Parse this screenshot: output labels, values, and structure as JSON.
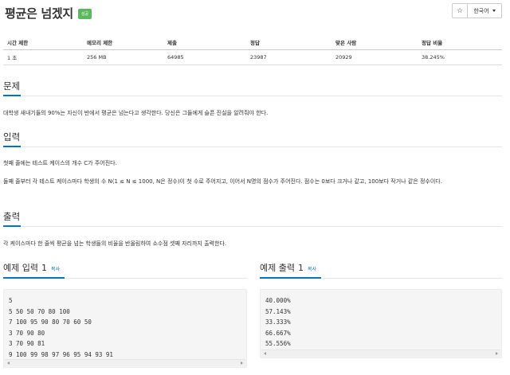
{
  "problem": {
    "title": "평균은 넘겠지",
    "badge": "성공"
  },
  "controls": {
    "star": "☆",
    "language": "한국어"
  },
  "info_table": {
    "headers": [
      "시간 제한",
      "메모리 제한",
      "제출",
      "정답",
      "맞은 사람",
      "정답 비율"
    ],
    "values": [
      "1 초",
      "256 MB",
      "64985",
      "23987",
      "20929",
      "38.245%"
    ]
  },
  "sections": {
    "problem_title": "문제",
    "problem_text": "대학생 새내기들의 90%는 자신이 반에서 평균은 넘는다고 생각한다. 당신은 그들에게 슬픈 진실을 알려줘야 한다.",
    "input_title": "입력",
    "input_text_1": "첫째 줄에는 테스트 케이스의 개수 C가 주어진다.",
    "input_text_2": "둘째 줄부터 각 테스트 케이스마다 학생의 수 N(1 ≤ N ≤ 1000, N은 정수)이 첫 수로 주어지고, 이어서 N명의 점수가 주어진다. 점수는 0보다 크거나 같고, 100보다 작거나 같은 정수이다.",
    "output_title": "출력",
    "output_text": "각 케이스마다 한 줄씩 평균을 넘는 학생들의 비율을 반올림하여 소수점 셋째 자리까지 출력한다."
  },
  "example_input": {
    "title": "예제 입력",
    "number": "1",
    "copy_label": "복사",
    "lines": [
      "5",
      "5 50 50 70 80 100",
      "7 100 95 90 80 70 60 50",
      "3 70 90 80",
      "3 70 90 81",
      "9 100 99 98 97 96 95 94 93 91"
    ]
  },
  "example_output": {
    "title": "예제 출력",
    "number": "1",
    "copy_label": "복사",
    "lines": [
      "40.000%",
      "57.143%",
      "33.333%",
      "66.667%",
      "55.556%"
    ]
  },
  "colors": {
    "accent": "#0076c0",
    "badge": "#5cb85c"
  }
}
